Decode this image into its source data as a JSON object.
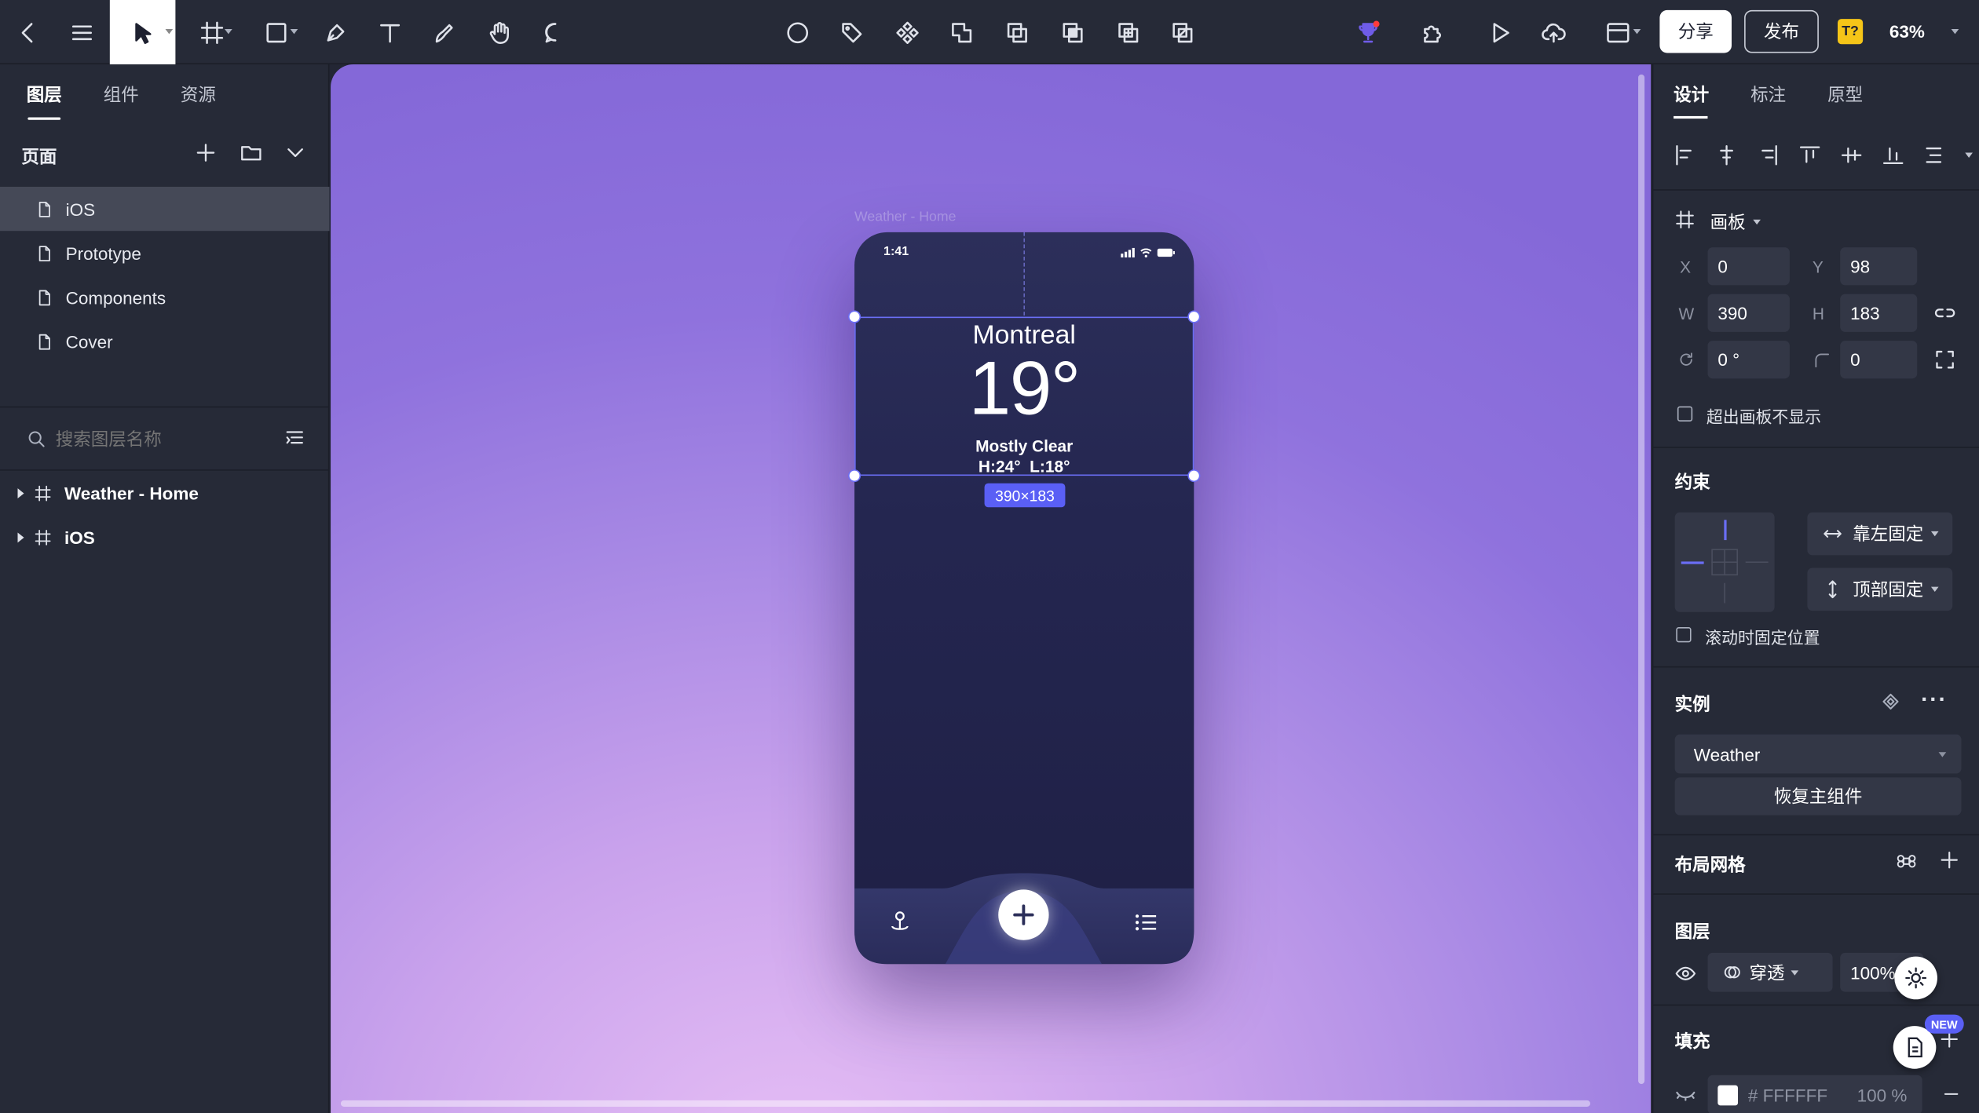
{
  "toolbar": {
    "share_label": "分享",
    "publish_label": "发布",
    "plugin_badge": "T?",
    "zoom": "63%"
  },
  "left_panel": {
    "tabs": [
      "图层",
      "组件",
      "资源"
    ],
    "pages_title": "页面",
    "pages": [
      "iOS",
      "Prototype",
      "Components",
      "Cover"
    ],
    "search_placeholder": "搜索图层名称",
    "layers": [
      "Weather - Home",
      "iOS"
    ]
  },
  "canvas": {
    "frame_label": "Weather - Home",
    "phone": {
      "time": "1:41",
      "city": "Montreal",
      "temperature": "19°",
      "condition": "Mostly Clear",
      "high_low": "H:24°  L:18°"
    },
    "selection_size": "390×183"
  },
  "right_panel": {
    "tabs": [
      "设计",
      "标注",
      "原型"
    ],
    "frame_type": "画板",
    "x_label": "X",
    "x": "0",
    "y_label": "Y",
    "y": "98",
    "w_label": "W",
    "w": "390",
    "h_label": "H",
    "h": "183",
    "rotation": "0 °",
    "radius": "0",
    "clip_label": "超出画板不显示",
    "constraints_title": "约束",
    "constraint_h": "靠左固定",
    "constraint_v": "顶部固定",
    "scroll_fix_label": "滚动时固定位置",
    "instance_title": "实例",
    "instance_name": "Weather",
    "restore_label": "恢复主组件",
    "grid_title": "布局网格",
    "layer_title": "图层",
    "blend_mode": "穿透",
    "opacity": "100%",
    "fill_title": "填充",
    "fill_hex": "# FFFFFF",
    "fill_opacity": "100 %",
    "new_badge": "NEW"
  },
  "colors": {
    "accent": "#5a5ff5",
    "panel": "#262a37",
    "canvas_top": "#8468d8",
    "canvas_bottom": "#e6bef5"
  }
}
